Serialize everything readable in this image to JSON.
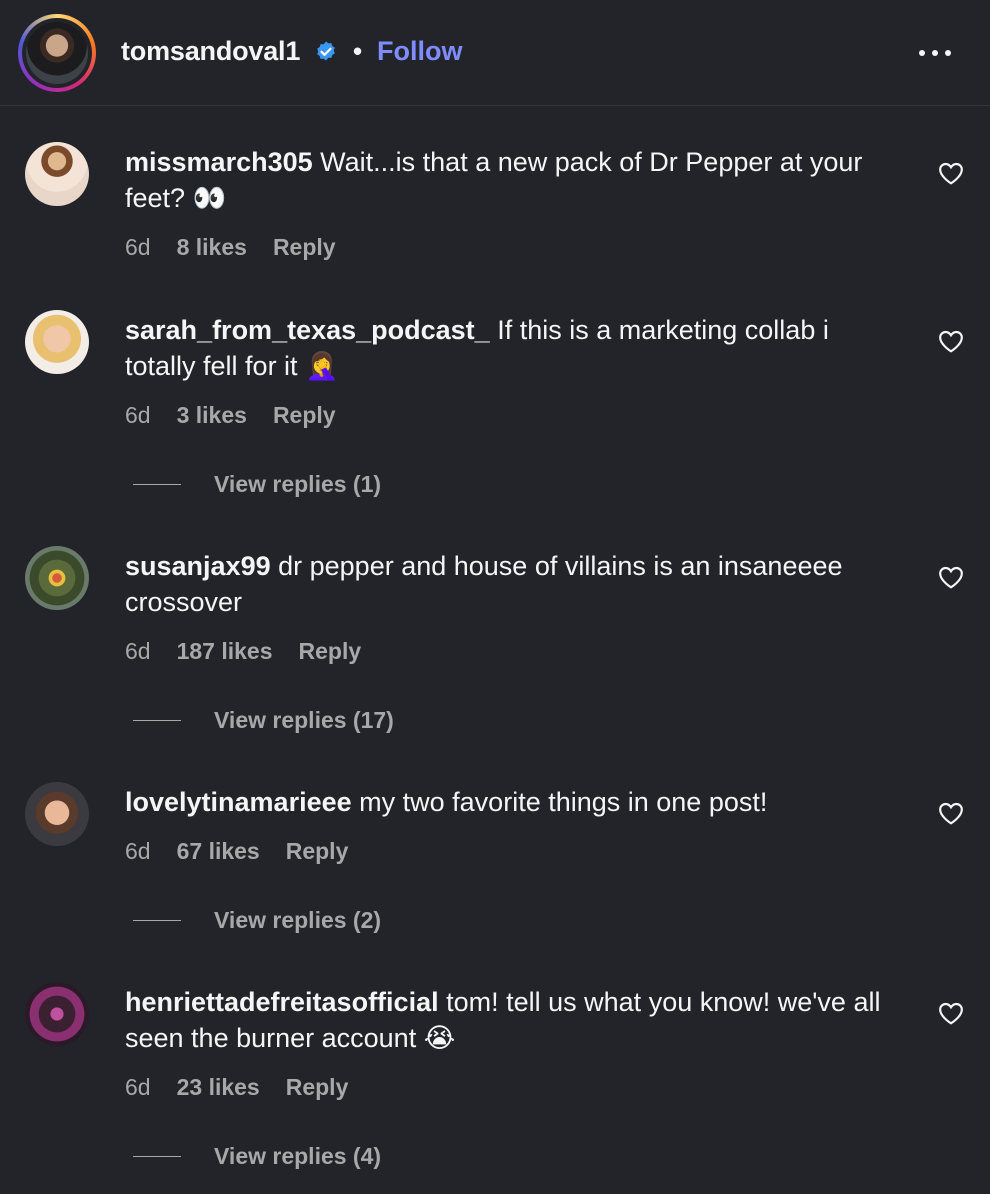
{
  "header": {
    "username": "tomsandoval1",
    "separator": "•",
    "follow_label": "Follow",
    "verified_icon": "verified-badge-icon",
    "more_icon": "more-options-icon"
  },
  "colors": {
    "background": "#222429",
    "text": "#f5f5f5",
    "muted": "#a8a8a8",
    "follow": "#7f8cff",
    "verified": "#3897f0"
  },
  "comments": [
    {
      "username": "missmarch305",
      "text": "Wait...is that a new pack of Dr Pepper at your feet? 👀",
      "time": "6d",
      "likes": "8 likes",
      "reply": "Reply"
    },
    {
      "username": "sarah_from_texas_podcast_",
      "text": "If this is a marketing collab i totally fell for it 🤦‍♀️",
      "time": "6d",
      "likes": "3 likes",
      "reply": "Reply",
      "view_replies": "View replies (1)"
    },
    {
      "username": "susanjax99",
      "text": "dr pepper and house of villains is an insaneeee crossover",
      "time": "6d",
      "likes": "187 likes",
      "reply": "Reply",
      "view_replies": "View replies (17)"
    },
    {
      "username": "lovelytinamarieee",
      "text": "my two favorite things in one post!",
      "time": "6d",
      "likes": "67 likes",
      "reply": "Reply",
      "view_replies": "View replies (2)"
    },
    {
      "username": "henriettadefreitasofficial",
      "text": "tom! tell us what you know! we've all seen the burner account 😭",
      "time": "6d",
      "likes": "23 likes",
      "reply": "Reply",
      "view_replies": "View replies (4)"
    }
  ]
}
